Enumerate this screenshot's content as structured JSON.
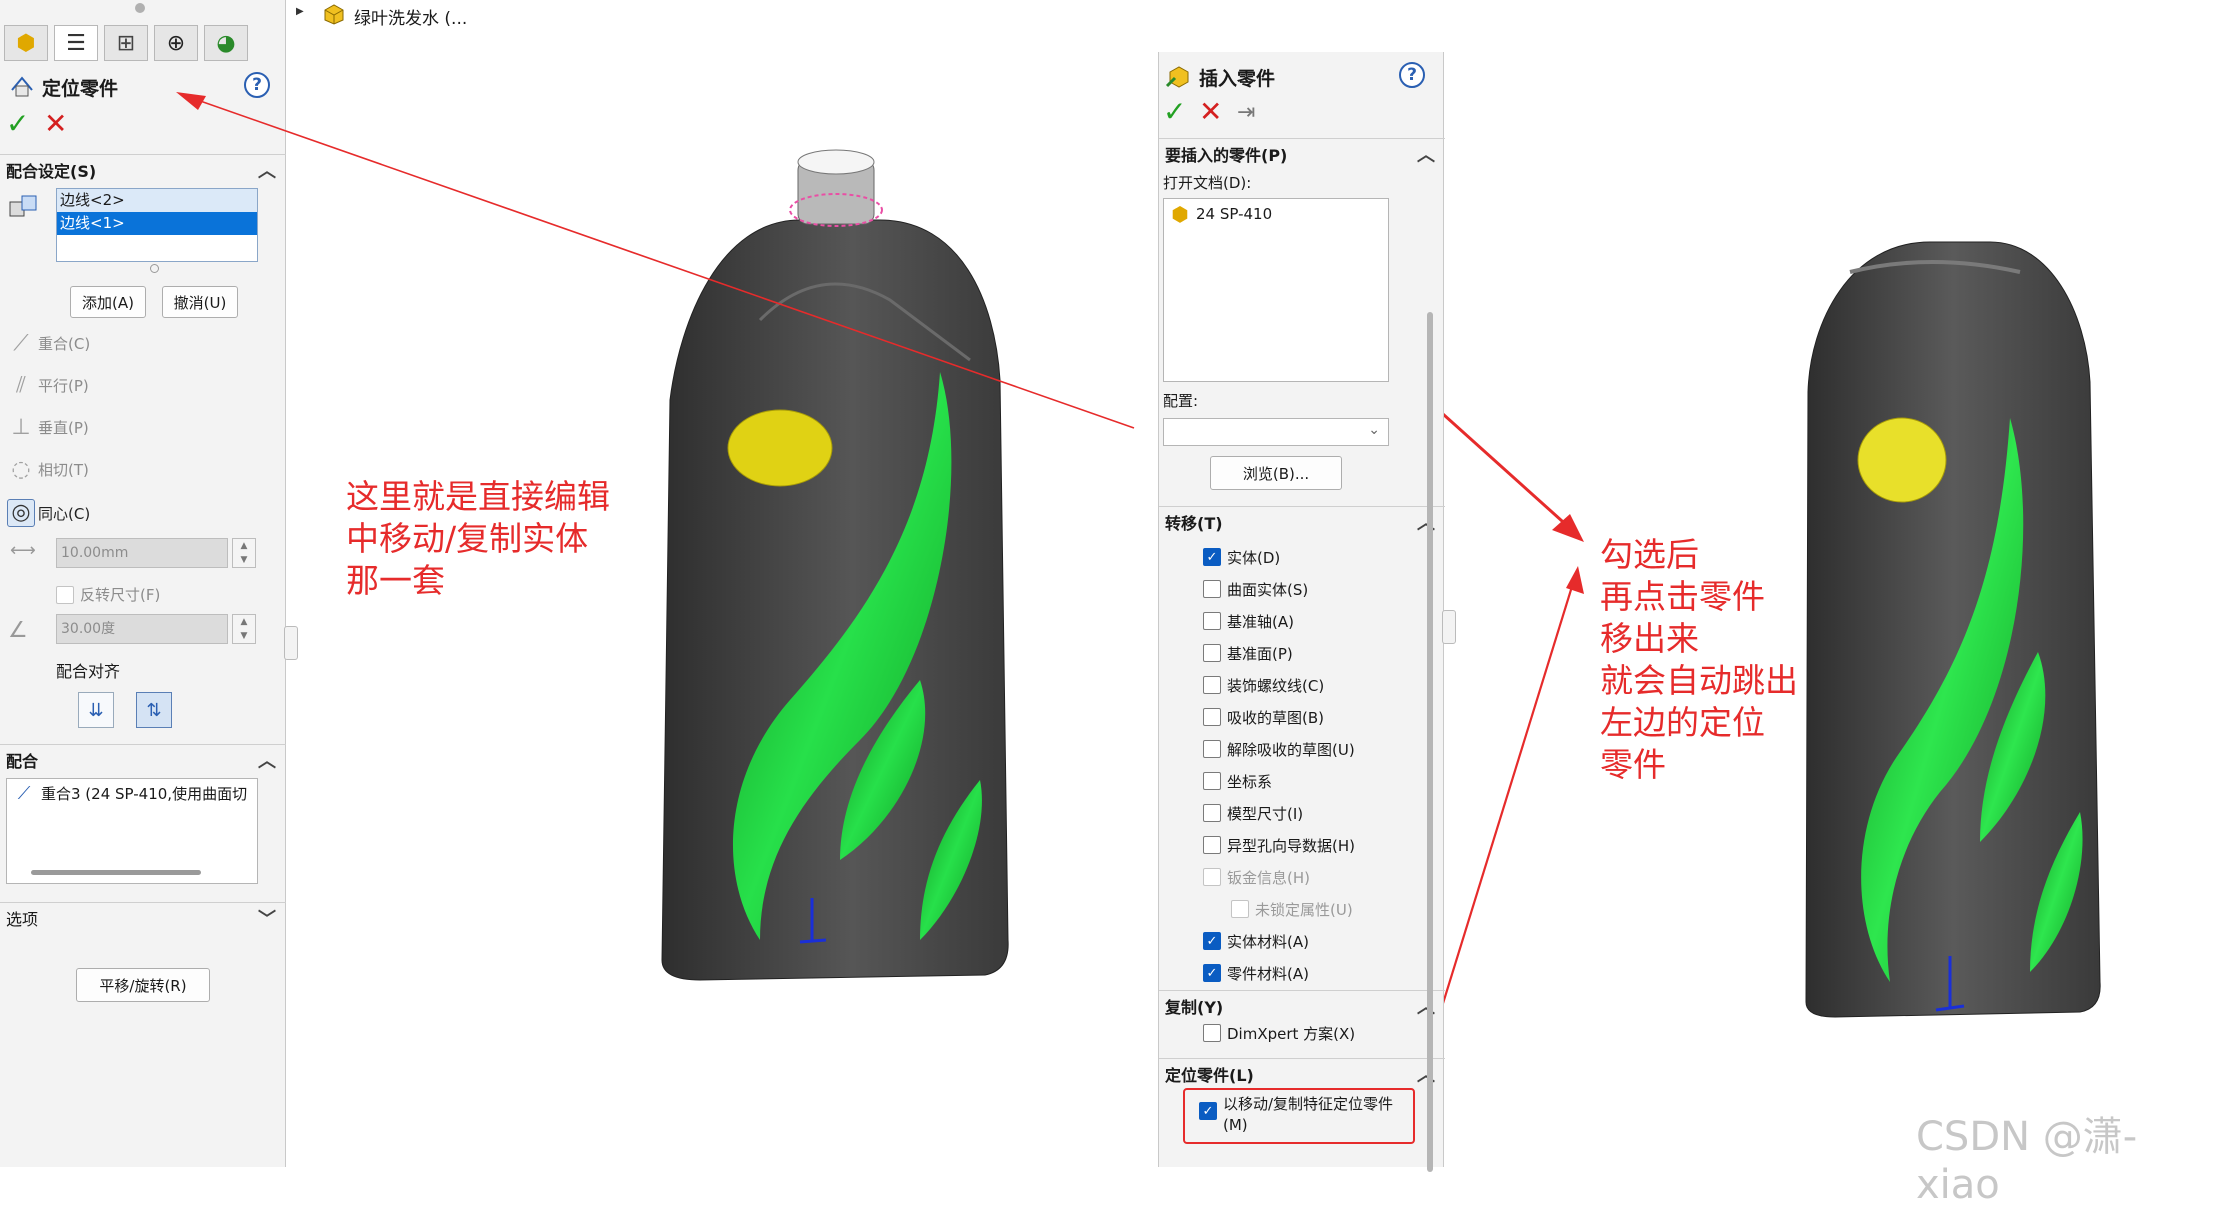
{
  "tree": {
    "document_name": "绿叶洗发水 (..."
  },
  "left_panel": {
    "title": "定位零件",
    "help_label": "?",
    "ok_label": "✓",
    "cancel_label": "✕",
    "mate_settings": {
      "header": "配合设定(S)",
      "items": [
        "边线<2>",
        "边线<1>"
      ],
      "add_label": "添加(A)",
      "undo_label": "撤消(U)"
    },
    "mate_types": [
      "重合(C)",
      "平行(P)",
      "垂直(P)",
      "相切(T)",
      "同心(C)"
    ],
    "distance_value": "10.00mm",
    "flip_dimension_label": "反转尺寸(F)",
    "angle_value": "30.00度",
    "mate_alignment_label": "配合对齐",
    "mates": {
      "header": "配合",
      "items": [
        "重合3 (24 SP-410,使用曲面切"
      ]
    },
    "options": {
      "header": "选项",
      "translate_rotate_label": "平移/旋转(R)"
    }
  },
  "right_panel": {
    "title": "插入零件",
    "help_label": "?",
    "ok_label": "✓",
    "cancel_label": "✕",
    "section_insert": {
      "header": "要插入的零件(P)",
      "open_docs_label": "打开文档(D):",
      "open_docs": [
        "24 SP-410"
      ]
    },
    "config_label": "配置:",
    "browse_label": "浏览(B)...",
    "transfer": {
      "header": "转移(T)",
      "items": [
        {
          "label": "实体(D)",
          "checked": true,
          "disabled": false
        },
        {
          "label": "曲面实体(S)",
          "checked": false,
          "disabled": false
        },
        {
          "label": "基准轴(A)",
          "checked": false,
          "disabled": false
        },
        {
          "label": "基准面(P)",
          "checked": false,
          "disabled": false
        },
        {
          "label": "装饰螺纹线(C)",
          "checked": false,
          "disabled": false
        },
        {
          "label": "吸收的草图(B)",
          "checked": false,
          "disabled": false
        },
        {
          "label": "解除吸收的草图(U)",
          "checked": false,
          "disabled": false
        },
        {
          "label": "坐标系",
          "checked": false,
          "disabled": false
        },
        {
          "label": "模型尺寸(I)",
          "checked": false,
          "disabled": false
        },
        {
          "label": "异型孔向导数据(H)",
          "checked": false,
          "disabled": false
        },
        {
          "label": "钣金信息(H)",
          "checked": false,
          "disabled": true
        },
        {
          "label": "未锁定属性(U)",
          "checked": false,
          "disabled": true
        },
        {
          "label": "实体材料(A)",
          "checked": true,
          "disabled": false
        },
        {
          "label": "零件材料(A)",
          "checked": true,
          "disabled": false
        }
      ]
    },
    "copy": {
      "header": "复制(Y)",
      "item": "DimXpert 方案(X)"
    },
    "locate": {
      "header": "定位零件(L)",
      "item": "以移动/复制特征定位零件(M)"
    }
  },
  "annotations": {
    "left_note": [
      "这里就是直接编辑",
      "中移动/复制实体",
      "那一套"
    ],
    "right_note": [
      "勾选后",
      "再点击零件",
      "移出来",
      "就会自动跳出",
      "左边的定位",
      "零件"
    ]
  },
  "watermark": "CSDN @潇-xiao",
  "colors": {
    "annotation": "#e62b2b",
    "selection": "#0a73d9",
    "bottle_body": "#4a4a4a",
    "leaf_green": "#1fd13a",
    "window_yellow": "#e0d214"
  }
}
